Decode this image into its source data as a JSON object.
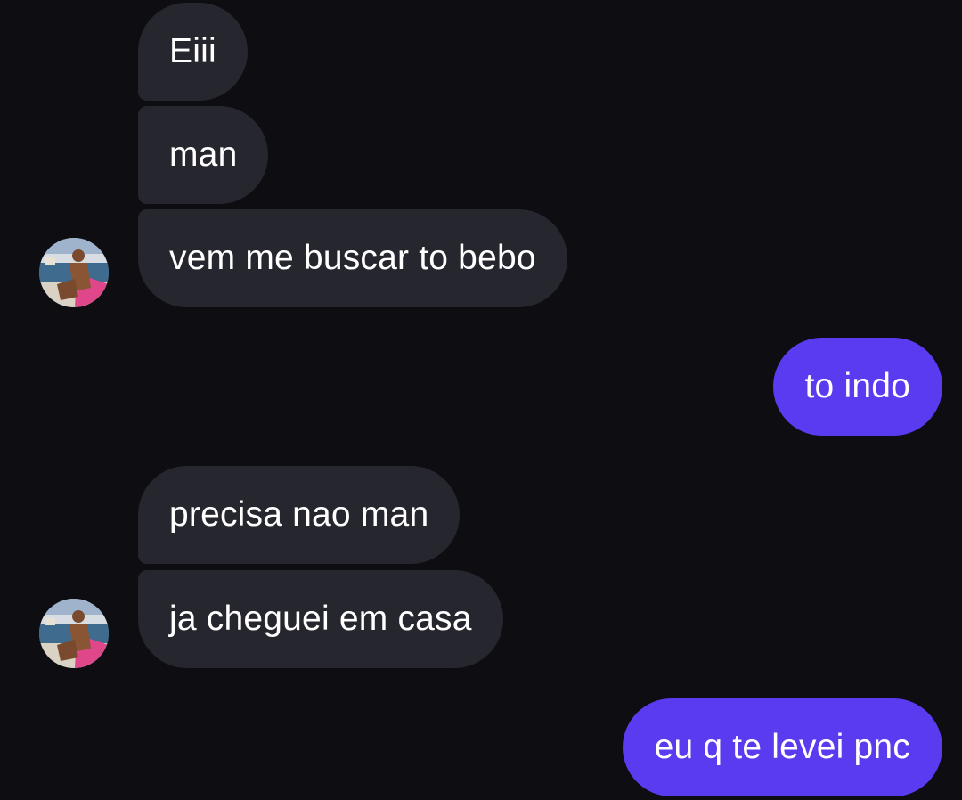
{
  "conversation": {
    "messages": [
      {
        "sender": "contact",
        "text": "Eiii"
      },
      {
        "sender": "contact",
        "text": "man"
      },
      {
        "sender": "contact",
        "text": "vem me buscar to bebo"
      },
      {
        "sender": "me",
        "text": "to indo"
      },
      {
        "sender": "contact",
        "text": "precisa nao man"
      },
      {
        "sender": "contact",
        "text": "ja cheguei em casa"
      },
      {
        "sender": "me",
        "text": "eu q te levei pnc"
      }
    ]
  },
  "colors": {
    "background": "#0d0d12",
    "received_bubble": "#26262e",
    "sent_bubble": "#5b3bf0",
    "text": "#ffffff"
  },
  "icons": {
    "contact_avatar": "contact-avatar-photo"
  }
}
